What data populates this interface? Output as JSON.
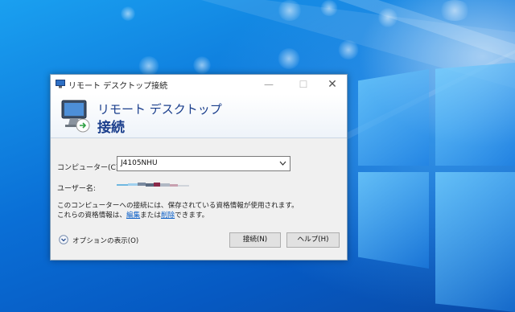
{
  "dialog": {
    "title": "リモート デスクトップ接続",
    "titlebar_buttons": {
      "minimize": "—",
      "maximize": "☐",
      "close": "✕"
    },
    "banner": {
      "line1": "リモート デスクトップ",
      "line2": "接続"
    },
    "computer_label": "コンピューター(C):",
    "computer_value": "J4105NHU",
    "user_label": "ユーザー名:",
    "user_value_masked": true,
    "info_text_part1": "このコンピューターへの接続には、保存されている資格情報が使用されます。これらの資格情報は、",
    "edit_link": "編集",
    "info_text_part2": "または",
    "delete_link": "削除",
    "info_text_part3": "できます。",
    "options_label": "オプションの表示(O)",
    "connect_button": "接続(N)",
    "help_button": "ヘルプ(H)"
  },
  "colors": {
    "desktop_blue": "#0a6fd6",
    "banner_text": "#1a3e8c",
    "link": "#0b5fc7"
  }
}
